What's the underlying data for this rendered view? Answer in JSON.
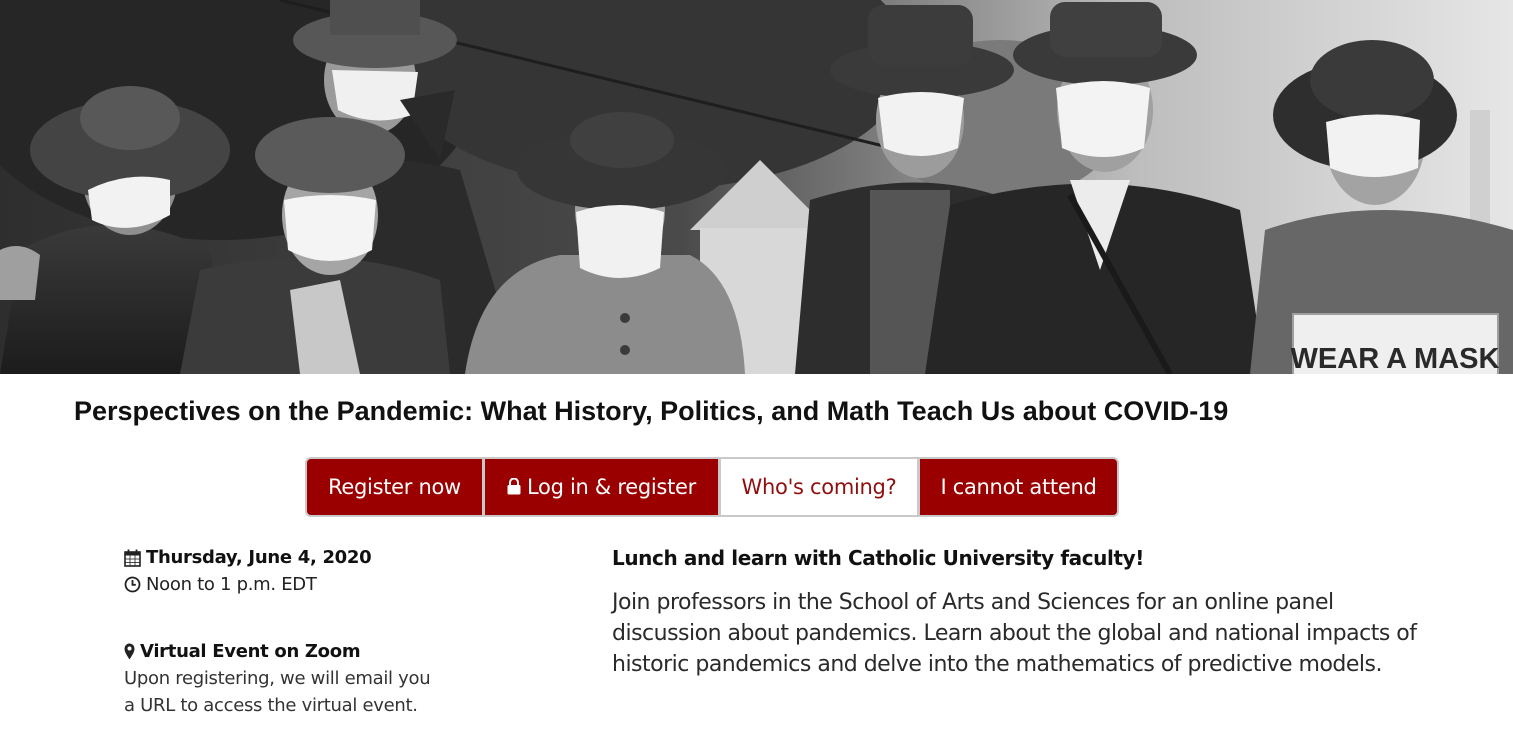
{
  "hero": {
    "image_alt": "Historic photograph of people wearing face masks during the 1918 pandemic",
    "sign_text": "WEAR A MASK"
  },
  "event": {
    "title": "Perspectives on the Pandemic: What History, Politics, and Math Teach Us about COVID-19"
  },
  "actions": {
    "register_now": "Register now",
    "login_register": "Log in & register",
    "whos_coming": "Who's coming?",
    "cannot_attend": "I cannot attend"
  },
  "details": {
    "date": "Thursday, June 4, 2020",
    "time": "Noon to 1 p.m. EDT",
    "location": "Virtual Event on Zoom",
    "location_note": "Upon registering, we will email you a URL to access the virtual event."
  },
  "description": {
    "heading": "Lunch and learn with Catholic University faculty!",
    "body": "Join professors in the School of Arts and Sciences for an online panel discussion about pandemics. Learn about the global and national impacts of historic pandemics and delve into the mathematics of predictive models."
  },
  "colors": {
    "brand_red": "#9b0000",
    "button_border": "#c9c9c9",
    "text_dark": "#111111"
  },
  "icons": {
    "date": "calendar-icon",
    "time": "clock-icon",
    "location": "map-marker-icon",
    "login": "lock-icon"
  }
}
